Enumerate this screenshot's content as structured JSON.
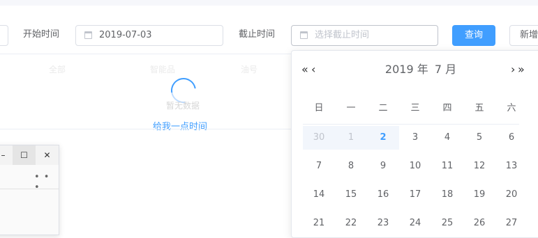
{
  "filter": {
    "start_label": "开始时间",
    "start_value": "2019-07-03",
    "end_label": "截止时间",
    "end_placeholder": "选择截止时间",
    "query_button": "查询",
    "new_button": "新增"
  },
  "table": {
    "headers": [
      "全部",
      "智能品",
      "油号"
    ],
    "empty_text": "暂无数据",
    "loading_text": "给我一点时间"
  },
  "window": {
    "minimize": "–",
    "maximize": "☐",
    "close": "✕",
    "more": "• • •"
  },
  "datepicker": {
    "prev_year": "«",
    "prev_month": "‹",
    "next_month": "›",
    "next_year": "»",
    "year": "2019 年",
    "month": "7 月",
    "weekdays": [
      "日",
      "一",
      "二",
      "三",
      "四",
      "五",
      "六"
    ],
    "weeks": [
      [
        "30",
        "1",
        "2",
        "3",
        "4",
        "5",
        "6"
      ],
      [
        "7",
        "8",
        "9",
        "10",
        "11",
        "12",
        "13"
      ],
      [
        "14",
        "15",
        "16",
        "17",
        "18",
        "19",
        "20"
      ],
      [
        "21",
        "22",
        "23",
        "24",
        "25",
        "26",
        "27"
      ]
    ],
    "today": "2",
    "prev_month_days": [
      "30"
    ],
    "accent_color": "#409eff"
  }
}
